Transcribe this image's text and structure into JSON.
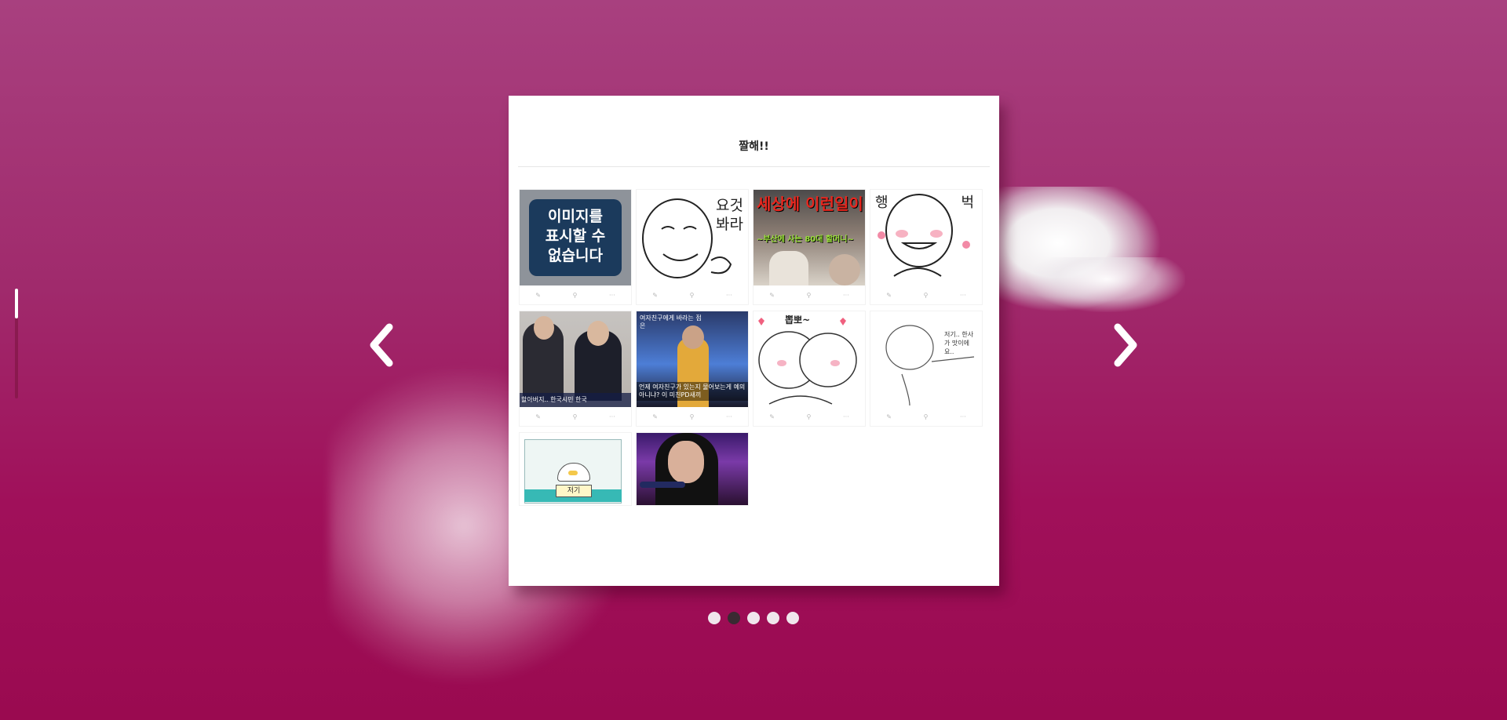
{
  "panel": {
    "title": "짤해!!"
  },
  "cards": [
    {
      "type": "unavailable",
      "text_line1": "이미지를",
      "text_line2": "표시할 수",
      "text_line3": "없습니다"
    },
    {
      "type": "meme",
      "text": "요것 봐라"
    },
    {
      "type": "photo",
      "headline": "세상에 이런일이",
      "subline": "~부산에 사는 80대 할머니~"
    },
    {
      "type": "meme",
      "text_left": "행",
      "text_right": "벅"
    },
    {
      "type": "photo",
      "caption": "할아버지.. 한국시민 한국"
    },
    {
      "type": "photo",
      "top_caption": "여자친구에게 바라는 점은",
      "caption": "언제 여자친구가 있는지 물어보는게 예의 아니냐? 이 미친PD새끼"
    },
    {
      "type": "meme",
      "text": "뽑뽀~"
    },
    {
      "type": "meme",
      "text": "저기.. 한사가 맛이에요.."
    },
    {
      "type": "meme",
      "text": "저기"
    },
    {
      "type": "photo"
    }
  ],
  "card_actions": {
    "edit_icon": "pencil-icon",
    "pin_icon": "pin-icon",
    "more_label": "···"
  },
  "navigation": {
    "prev_icon": "chevron-left-icon",
    "next_icon": "chevron-right-icon",
    "pages": 5,
    "active_page": 2
  },
  "colors": {
    "background_top": "#a8407f",
    "background_bottom": "#9a0a50",
    "panel": "#ffffff",
    "dot": "#f0e6ec",
    "dot_active": "#3a2a32"
  }
}
